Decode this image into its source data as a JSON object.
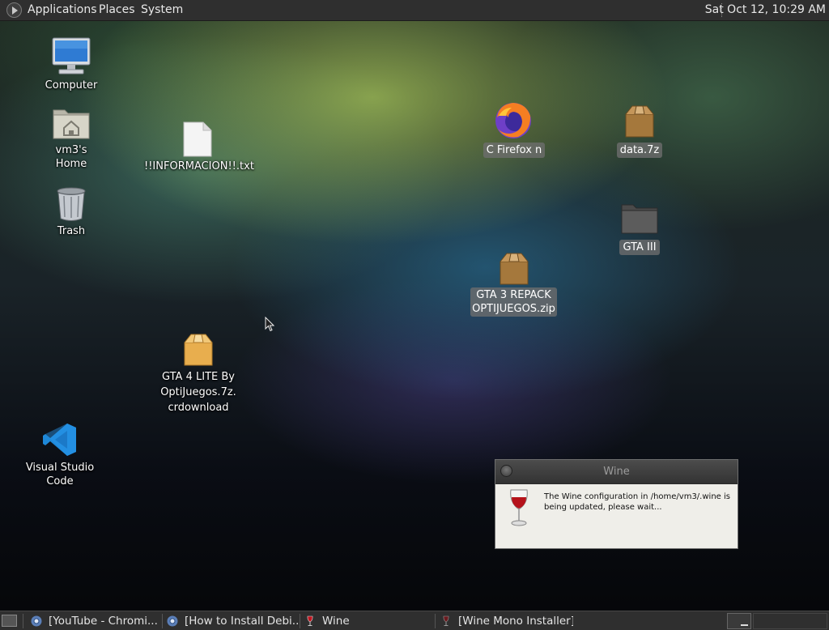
{
  "top_panel": {
    "menus": [
      "Applications",
      "Places",
      "System"
    ],
    "clock": "Sat Oct 12, 10:29 AM"
  },
  "desktop": {
    "icons": {
      "computer": "Computer",
      "home": "vm3's Home",
      "trash": "Trash",
      "info_txt": "!!INFORMACION!!.txt",
      "gta4_line1": "GTA 4 LITE By",
      "gta4_line2": "OptiJuegos.7z.",
      "gta4_line3": "crdownload",
      "vscode": "Visual Studio Code",
      "firefox": "C Firefox n",
      "data7z": "data.7z",
      "gta3_folder": "GTA III",
      "gta3_zip_line1": "GTA 3 REPACK",
      "gta3_zip_line2": "OPTIJUEGOS.zip"
    }
  },
  "wine_dialog": {
    "title": "Wine",
    "message": "The Wine configuration in /home/vm3/.wine is being updated, please wait..."
  },
  "taskbar": {
    "tasks": [
      {
        "label": "[YouTube - Chromi..."
      },
      {
        "label": "[How to Install Debi..."
      },
      {
        "label": "Wine"
      },
      {
        "label": "[Wine Mono Installer]"
      }
    ]
  },
  "colors": {
    "panel": "#2f2f2f",
    "folder_tan": "#e7b85e",
    "vscode_blue": "#1e88d8",
    "firefox_orange": "#f57e22"
  }
}
